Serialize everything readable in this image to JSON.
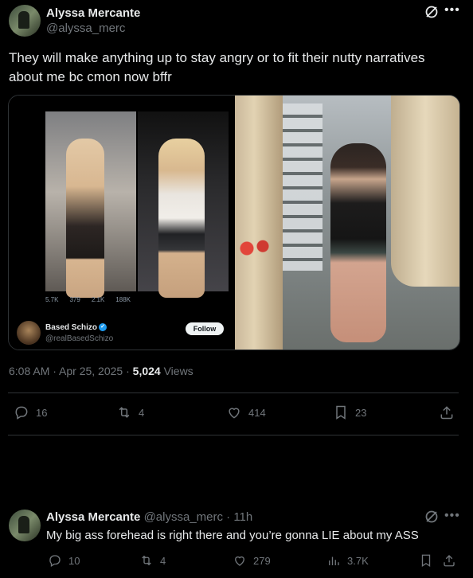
{
  "tweet": {
    "author_name": "Alyssa Mercante",
    "author_handle": "@alyssa_merc",
    "text": "They will make anything up to stay angry or to fit their nutty narratives about me bc cmon now bffr",
    "timestamp": "6:08 AM · Apr 25, 2025 · ",
    "views_count": "5,024",
    "views_label": " Views",
    "replies": "16",
    "reposts": "4",
    "likes": "414",
    "bookmarks": "23"
  },
  "embedded": {
    "stats": [
      "5.7K",
      "379",
      "2.1K",
      "188K"
    ],
    "author_name": "Based Schizo",
    "author_handle": "@realBasedSchizo",
    "follow_label": "Follow"
  },
  "reply": {
    "author_name": "Alyssa Mercante",
    "author_handle_time": "@alyssa_merc · 11h",
    "text": "My big ass forehead is right there and you’re gonna LIE about my ASS",
    "replies": "10",
    "reposts": "4",
    "likes": "279",
    "views": "3.7K"
  }
}
